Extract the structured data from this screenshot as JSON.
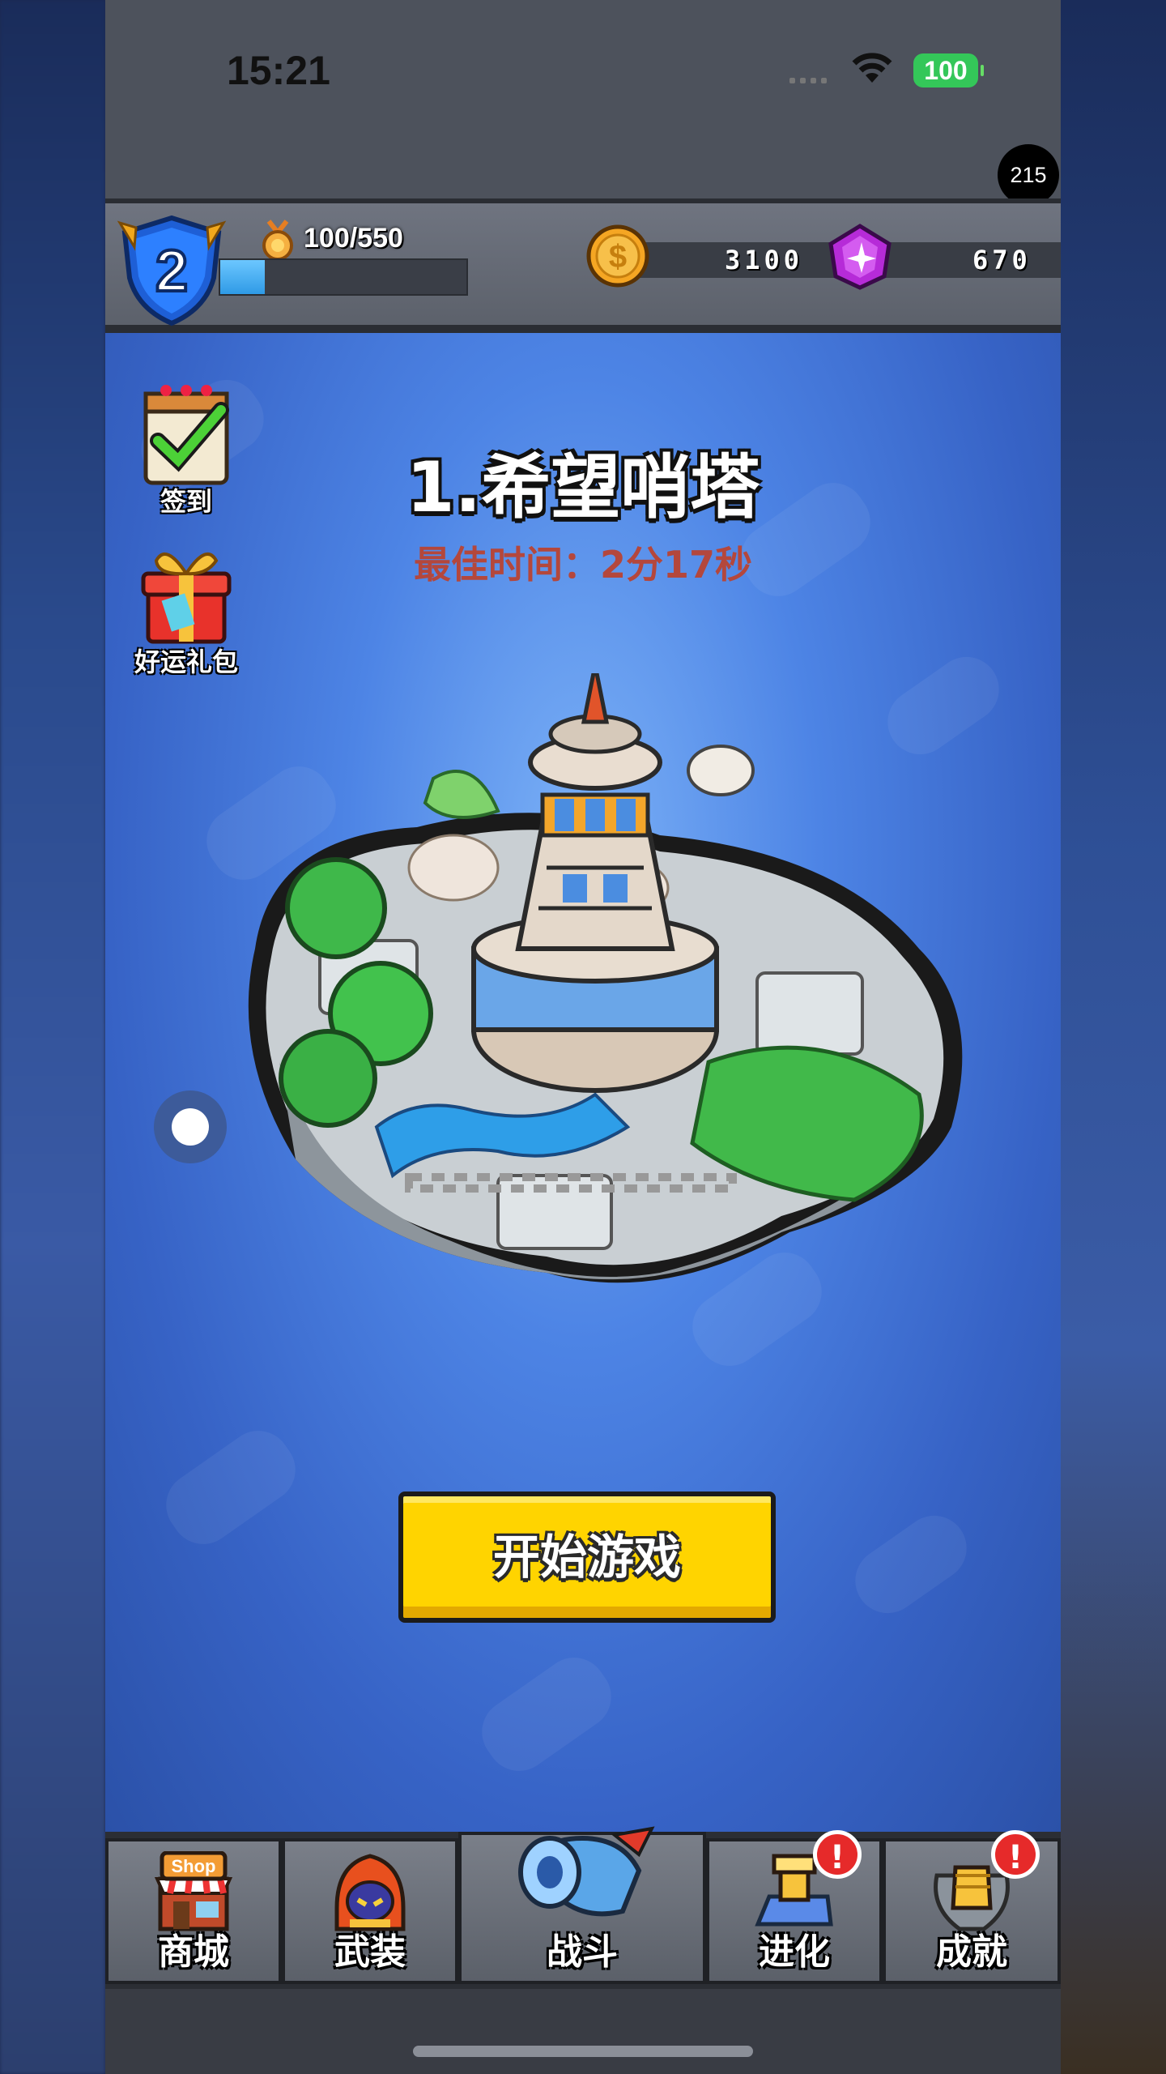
{
  "status_bar": {
    "time": "15:21",
    "battery": "100"
  },
  "overlay_badge": "215",
  "hud": {
    "level": "2",
    "xp_text": "100/550",
    "xp_progress": 0.18,
    "coins": "3100",
    "gems": "670"
  },
  "side_buttons": {
    "checkin": "签到",
    "lucky_pack": "好运礼包"
  },
  "stage": {
    "title": "1.希望哨塔",
    "best_time": "最佳时间：2分17秒"
  },
  "start_button": "开始游戏",
  "nav": {
    "shop": "商城",
    "shop_sign": "Shop",
    "armory": "武装",
    "battle": "战斗",
    "evolve": "进化",
    "achievements": "成就",
    "alert_mark": "!"
  },
  "colors": {
    "start_yellow": "#ffd400",
    "best_time_red": "#b4473c",
    "alert_red": "#e62a2a",
    "battery_green": "#34c759"
  }
}
